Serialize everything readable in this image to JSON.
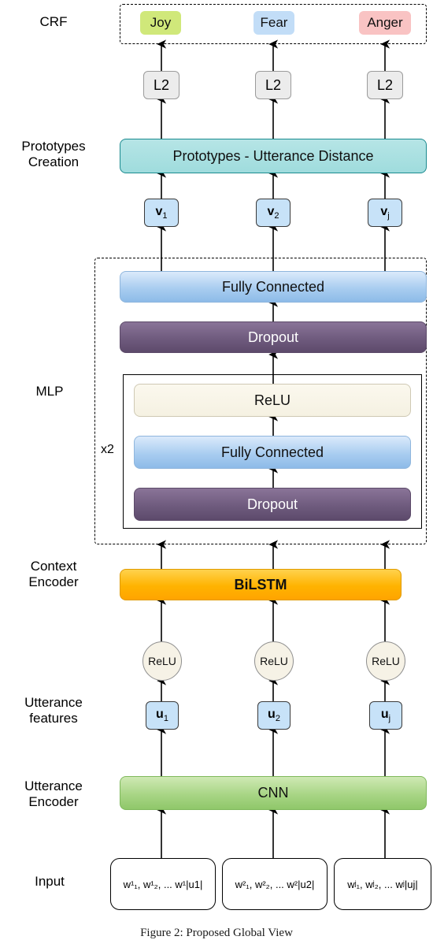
{
  "figure": {
    "title": "Model architecture diagram",
    "caption": "Figure 2: Proposed Global View"
  },
  "stages": [
    {
      "id": "crf",
      "label": "CRF"
    },
    {
      "id": "prototypes_creation",
      "label": "Prototypes\nCreation"
    },
    {
      "id": "mlp",
      "label": "MLP"
    },
    {
      "id": "context_encoder",
      "label": "Context\nEncoder"
    },
    {
      "id": "utterance_features",
      "label": "Utterance\nfeatures"
    },
    {
      "id": "utterance_encoder",
      "label": "Utterance\nEncoder"
    },
    {
      "id": "input",
      "label": "Input"
    }
  ],
  "crf": {
    "emotions": [
      {
        "label": "Joy",
        "color": "#d0e87a"
      },
      {
        "label": "Fear",
        "color": "#c2ddf7"
      },
      {
        "label": "Anger",
        "color": "#f9c3c3"
      }
    ]
  },
  "norm_layers": [
    {
      "label": "L2"
    },
    {
      "label": "L2"
    },
    {
      "label": "L2"
    }
  ],
  "prototypes": {
    "bar_label": "Prototypes - Utterance Distance",
    "color": "#9fdcdd"
  },
  "prototype_vectors": [
    {
      "symbol": "v",
      "sub": "1"
    },
    {
      "symbol": "v",
      "sub": "2"
    },
    {
      "symbol": "v",
      "sub": "j"
    }
  ],
  "mlp": {
    "outer_label": "MLP",
    "repeat_label": "x2",
    "outer_layers": [
      {
        "label": "Fully Connected",
        "style": "blue"
      },
      {
        "label": "Dropout",
        "style": "purple"
      }
    ],
    "inner_layers": [
      {
        "label": "ReLU",
        "style": "cream"
      },
      {
        "label": "Fully Connected",
        "style": "blue"
      },
      {
        "label": "Dropout",
        "style": "purple"
      }
    ]
  },
  "context_encoder": {
    "bar_label": "BiLSTM",
    "color": "#ffb300",
    "activations": [
      {
        "label": "ReLU"
      },
      {
        "label": "ReLU"
      },
      {
        "label": "ReLU"
      }
    ]
  },
  "utterance_features": [
    {
      "symbol": "u",
      "sub": "1"
    },
    {
      "symbol": "u",
      "sub": "2"
    },
    {
      "symbol": "u",
      "sub": "j"
    }
  ],
  "utterance_encoder": {
    "bar_label": "CNN",
    "color": "#8fc76a"
  },
  "inputs": [
    {
      "tokens": "w¹₁, w¹₂, ... w¹|u1|",
      "sup": "1",
      "len_sub": "|u1|"
    },
    {
      "tokens": "w²₁, w²₂, ... w²|u2|",
      "sup": "2",
      "len_sub": "|u2|"
    },
    {
      "tokens": "wʲ₁, wʲ₂, ... wʲ|uj|",
      "sup": "j",
      "len_sub": "|uj|"
    }
  ]
}
